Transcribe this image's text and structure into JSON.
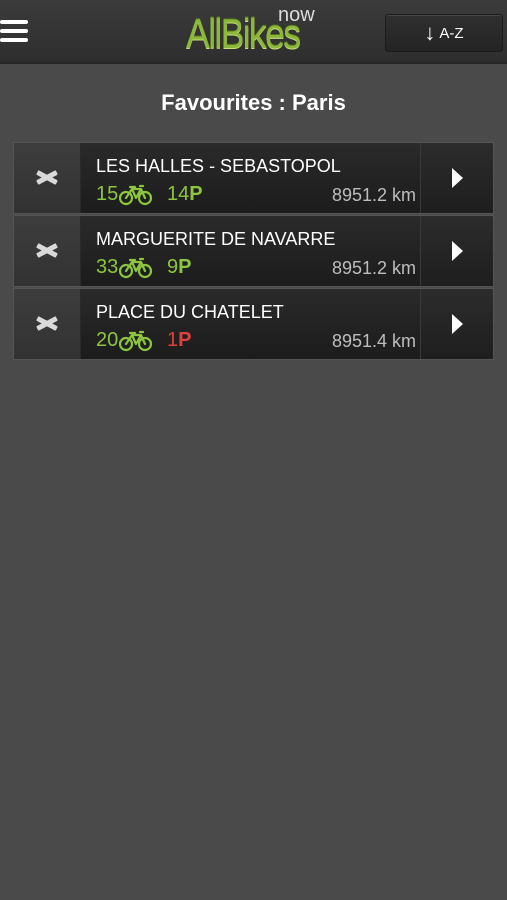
{
  "header": {
    "logo_main": "AllBikes",
    "logo_sub": "now",
    "sort_arrow": "↓",
    "sort_label": "A-Z"
  },
  "page_title": "Favourites : Paris",
  "colors": {
    "accent_green": "#8cc63f",
    "alert_red": "#e0413c"
  },
  "stations": [
    {
      "name": "LES HALLES - SEBASTOPOL",
      "bikes": "15",
      "parking": "14",
      "parking_suffix": "P",
      "parking_status": "green",
      "distance": "8951.2 km"
    },
    {
      "name": "MARGUERITE DE NAVARRE",
      "bikes": "33",
      "parking": "9",
      "parking_suffix": "P",
      "parking_status": "green",
      "distance": "8951.2 km"
    },
    {
      "name": "PLACE DU CHATELET",
      "bikes": "20",
      "parking": "1",
      "parking_suffix": "P",
      "parking_status": "red",
      "distance": "8951.4 km"
    }
  ]
}
